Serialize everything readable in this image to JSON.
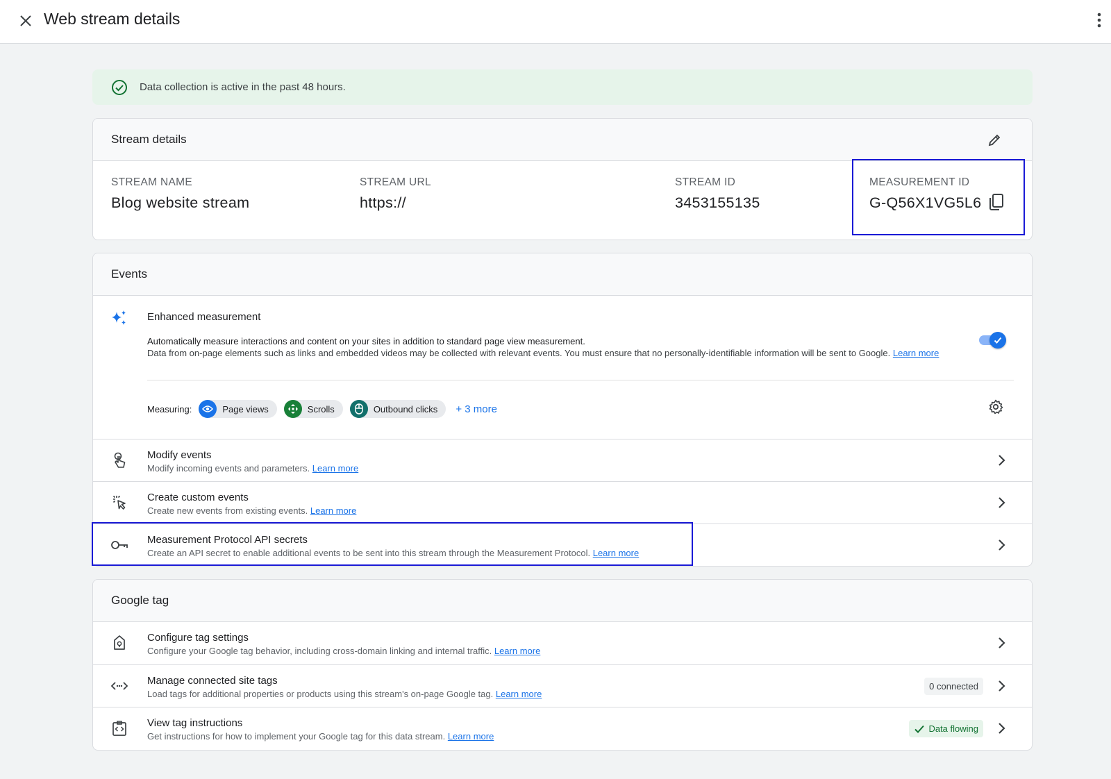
{
  "topbar": {
    "title": "Web stream details"
  },
  "banner": {
    "text": "Data collection is active in the past 48 hours."
  },
  "stream_details": {
    "header": "Stream details",
    "fields": [
      {
        "label": "STREAM NAME",
        "value": "Blog website stream"
      },
      {
        "label": "STREAM URL",
        "value": "https://"
      },
      {
        "label": "STREAM ID",
        "value": "3453155135"
      },
      {
        "label": "MEASUREMENT ID",
        "value": "G-Q56X1VG5L6"
      }
    ]
  },
  "events": {
    "header": "Events",
    "enhanced": {
      "title": "Enhanced measurement",
      "desc1": "Automatically measure interactions and content on your sites in addition to standard page view measurement.",
      "desc2": "Data from on-page elements such as links and embedded videos may be collected with relevant events. You must ensure that no personally-identifiable information will be sent to Google.",
      "learn_more": "Learn more",
      "measuring_label": "Measuring:",
      "chips": [
        "Page views",
        "Scrolls",
        "Outbound clicks"
      ],
      "more": "+ 3 more",
      "toggle_on": true
    },
    "rows": [
      {
        "title": "Modify events",
        "sub": "Modify incoming events and parameters.",
        "link": "Learn more"
      },
      {
        "title": "Create custom events",
        "sub": "Create new events from existing events.",
        "link": "Learn more"
      },
      {
        "title": "Measurement Protocol API secrets",
        "sub": "Create an API secret to enable additional events to be sent into this stream through the Measurement Protocol.",
        "link": "Learn more"
      }
    ]
  },
  "google_tag": {
    "header": "Google tag",
    "rows": [
      {
        "title": "Configure tag settings",
        "sub": "Configure your Google tag behavior, including cross-domain linking and internal traffic.",
        "link": "Learn more"
      },
      {
        "title": "Manage connected site tags",
        "sub": "Load tags for additional properties or products using this stream's on-page Google tag.",
        "link": "Learn more",
        "badge": "0 connected"
      },
      {
        "title": "View tag instructions",
        "sub": "Get instructions for how to implement your Google tag for this data stream.",
        "link": "Learn more",
        "badge": "Data flowing"
      }
    ]
  },
  "colors": {
    "accent": "#1a73e8",
    "success_bg": "#e6f4ea",
    "success": "#137333",
    "highlight": "#1a1ad6"
  }
}
